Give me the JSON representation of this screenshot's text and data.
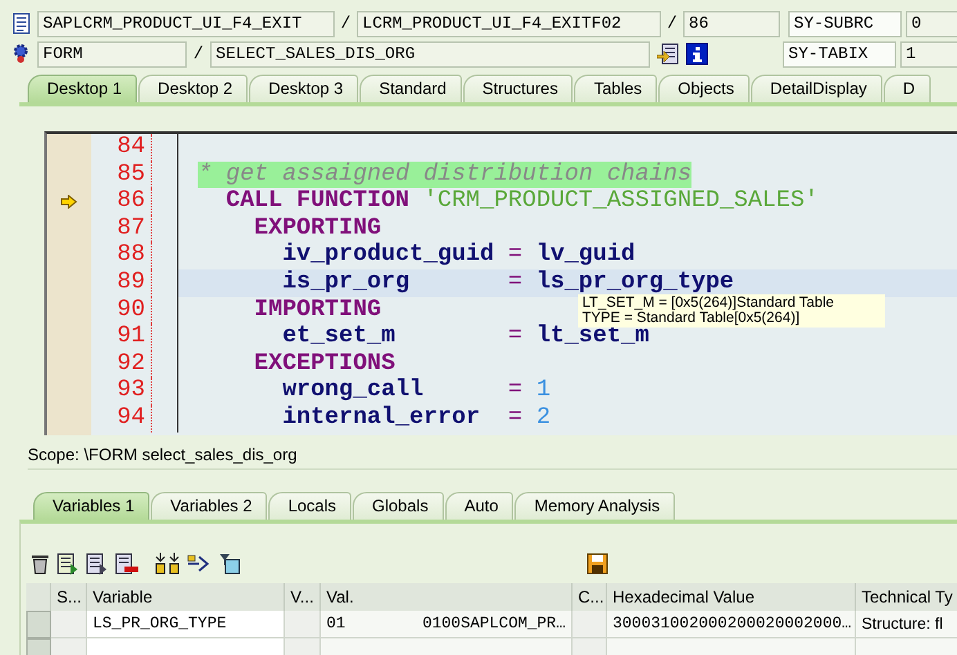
{
  "header": {
    "row_1": {
      "program": "SAPLCRM_PRODUCT_UI_F4_EXIT",
      "separator_1": "/",
      "include": "LCRM_PRODUCT_UI_F4_EXITF02",
      "separator_2": "/",
      "line": "86",
      "sys_field": "SY-SUBRC",
      "sys_value": "0"
    },
    "row_2": {
      "event_type": "FORM",
      "separator": "/",
      "event": "SELECT_SALES_DIS_ORG",
      "sys_field": "SY-TABIX",
      "sys_value": "1"
    }
  },
  "desktop_tabs": [
    {
      "label": "Desktop 1",
      "selected": true
    },
    {
      "label": "Desktop 2",
      "selected": false
    },
    {
      "label": "Desktop 3",
      "selected": false
    },
    {
      "label": "Standard",
      "selected": false
    },
    {
      "label": "Structures",
      "selected": false
    },
    {
      "label": "Tables",
      "selected": false
    },
    {
      "label": "Objects",
      "selected": false
    },
    {
      "label": "DetailDisplay",
      "selected": false
    },
    {
      "label": "D",
      "selected": false
    }
  ],
  "editor": {
    "lines": [
      {
        "number": "84",
        "kind": "blank",
        "current": false,
        "highlighted": false
      },
      {
        "number": "85",
        "kind": "comment",
        "current": false,
        "highlighted": false,
        "text": "* get assaigned distribution chains"
      },
      {
        "number": "86",
        "kind": "call",
        "current": true,
        "highlighted": false,
        "keyword": "CALL FUNCTION",
        "value": "'CRM_PRODUCT_ASSIGNED_SALES'"
      },
      {
        "number": "87",
        "kind": "section",
        "current": false,
        "highlighted": false,
        "keyword": "EXPORTING"
      },
      {
        "number": "88",
        "kind": "param",
        "current": false,
        "highlighted": false,
        "name": "iv_product_guid",
        "operator": "=",
        "value": "lv_guid"
      },
      {
        "number": "89",
        "kind": "param",
        "current": false,
        "highlighted": true,
        "name": "is_pr_org",
        "operator": "=",
        "value": "ls_pr_org_type"
      },
      {
        "number": "90",
        "kind": "section",
        "current": false,
        "highlighted": false,
        "keyword": "IMPORTING"
      },
      {
        "number": "91",
        "kind": "param",
        "current": false,
        "highlighted": false,
        "name": "et_set_m",
        "operator": "=",
        "value": "lt_set_m"
      },
      {
        "number": "92",
        "kind": "section",
        "current": false,
        "highlighted": false,
        "keyword": "EXCEPTIONS"
      },
      {
        "number": "93",
        "kind": "param_literal",
        "current": false,
        "highlighted": false,
        "name": "wrong_call",
        "operator": "=",
        "value": "1"
      },
      {
        "number": "94",
        "kind": "param_literal",
        "current": false,
        "highlighted": false,
        "name": "internal_error",
        "operator": "=",
        "value": "2"
      }
    ],
    "tooltip": [
      "LT_SET_M = [0x5(264)]Standard Table",
      "TYPE  = Standard Table[0x5(264)]"
    ]
  },
  "scope": "Scope: \\FORM select_sales_dis_org",
  "variable_tabs": [
    {
      "label": "Variables 1",
      "selected": true
    },
    {
      "label": "Variables 2",
      "selected": false
    },
    {
      "label": "Locals",
      "selected": false
    },
    {
      "label": "Globals",
      "selected": false
    },
    {
      "label": "Auto",
      "selected": false
    },
    {
      "label": "Memory Analysis",
      "selected": false
    }
  ],
  "table": {
    "columns": [
      "S...",
      "Variable",
      "V...",
      "Val.",
      "C...",
      "Hexadecimal Value",
      "Technical Ty"
    ],
    "rows": [
      {
        "variable": "LS_PR_ORG_TYPE",
        "value_1": "01",
        "value_2": "0100SAPLCOM_PR…",
        "hexadecimal": "300031002000200020002000…",
        "technical_type": "Structure: fl"
      }
    ]
  }
}
